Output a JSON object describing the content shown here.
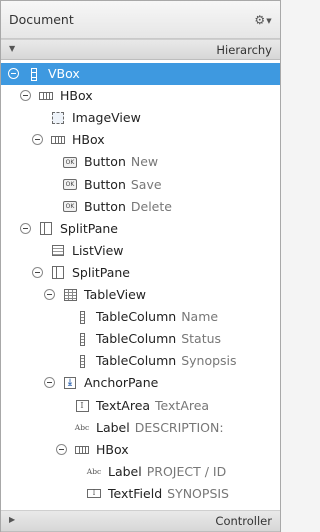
{
  "header": {
    "title": "Document",
    "gear_symbol": "⚙",
    "caret_symbol": "▼"
  },
  "hierarchy": {
    "label": "Hierarchy",
    "arrow": "▼"
  },
  "controller": {
    "label": "Controller",
    "arrow": "▶"
  },
  "tree": [
    {
      "type": "VBox",
      "detail": "",
      "icon": "vbox-icon",
      "depth": 0,
      "expandable": true,
      "selected": true
    },
    {
      "type": "HBox",
      "detail": "",
      "icon": "hbox-icon",
      "depth": 1,
      "expandable": true,
      "selected": false
    },
    {
      "type": "ImageView",
      "detail": "",
      "icon": "imageview-icon",
      "depth": 2,
      "expandable": false,
      "selected": false
    },
    {
      "type": "HBox",
      "detail": "",
      "icon": "hbox-icon",
      "depth": 2,
      "expandable": true,
      "selected": false
    },
    {
      "type": "Button",
      "detail": "New",
      "icon": "button-icon",
      "depth": 3,
      "expandable": false,
      "selected": false
    },
    {
      "type": "Button",
      "detail": "Save",
      "icon": "button-icon",
      "depth": 3,
      "expandable": false,
      "selected": false
    },
    {
      "type": "Button",
      "detail": "Delete",
      "icon": "button-icon",
      "depth": 3,
      "expandable": false,
      "selected": false
    },
    {
      "type": "SplitPane",
      "detail": "",
      "icon": "splitpane-icon",
      "depth": 1,
      "expandable": true,
      "selected": false
    },
    {
      "type": "ListView",
      "detail": "",
      "icon": "listview-icon",
      "depth": 2,
      "expandable": false,
      "selected": false
    },
    {
      "type": "SplitPane",
      "detail": "",
      "icon": "splitpane-icon",
      "depth": 2,
      "expandable": true,
      "selected": false
    },
    {
      "type": "TableView",
      "detail": "",
      "icon": "tableview-icon",
      "depth": 3,
      "expandable": true,
      "selected": false
    },
    {
      "type": "TableColumn",
      "detail": "Name",
      "icon": "tablecolumn-icon",
      "depth": 4,
      "expandable": false,
      "selected": false
    },
    {
      "type": "TableColumn",
      "detail": "Status",
      "icon": "tablecolumn-icon",
      "depth": 4,
      "expandable": false,
      "selected": false
    },
    {
      "type": "TableColumn",
      "detail": "Synopsis",
      "icon": "tablecolumn-icon",
      "depth": 4,
      "expandable": false,
      "selected": false
    },
    {
      "type": "AnchorPane",
      "detail": "",
      "icon": "anchorpane-icon",
      "depth": 3,
      "expandable": true,
      "selected": false
    },
    {
      "type": "TextArea",
      "detail": "TextArea",
      "icon": "textarea-icon",
      "depth": 4,
      "expandable": false,
      "selected": false
    },
    {
      "type": "Label",
      "detail": "DESCRIPTION:",
      "icon": "label-icon",
      "depth": 4,
      "expandable": false,
      "selected": false
    },
    {
      "type": "HBox",
      "detail": "",
      "icon": "hbox-icon",
      "depth": 4,
      "expandable": true,
      "selected": false
    },
    {
      "type": "Label",
      "detail": "PROJECT / ID",
      "icon": "label-icon",
      "depth": 5,
      "expandable": false,
      "selected": false
    },
    {
      "type": "TextField",
      "detail": "SYNOPSIS",
      "icon": "textfield-icon",
      "depth": 5,
      "expandable": false,
      "selected": false
    }
  ]
}
